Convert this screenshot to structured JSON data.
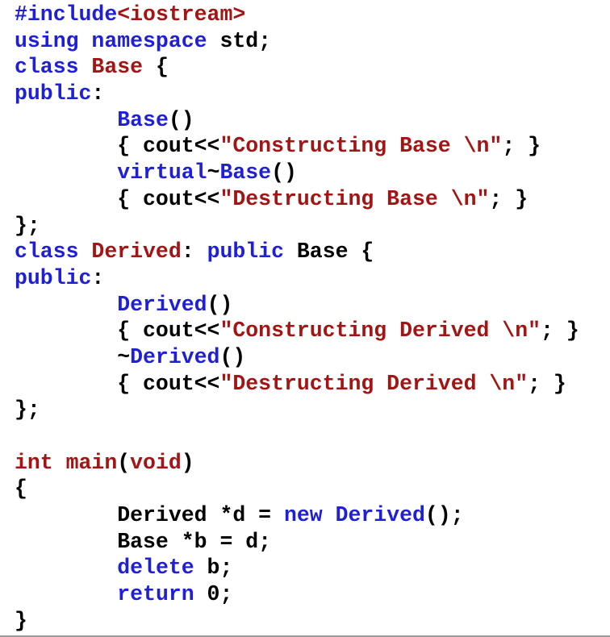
{
  "code": {
    "lines": [
      [
        {
          "t": "#include",
          "c": "blue"
        },
        {
          "t": "<iostream>",
          "c": "red"
        }
      ],
      [
        {
          "t": "using",
          "c": "blue"
        },
        {
          "t": " ",
          "c": "black"
        },
        {
          "t": "namespace",
          "c": "blue"
        },
        {
          "t": " std;",
          "c": "black"
        }
      ],
      [
        {
          "t": "class",
          "c": "blue"
        },
        {
          "t": " ",
          "c": "black"
        },
        {
          "t": "Base",
          "c": "red"
        },
        {
          "t": " {",
          "c": "black"
        }
      ],
      [
        {
          "t": "public",
          "c": "blue"
        },
        {
          "t": ":",
          "c": "black"
        }
      ],
      [
        {
          "t": "        ",
          "c": "black"
        },
        {
          "t": "Base",
          "c": "blue"
        },
        {
          "t": "()",
          "c": "black"
        }
      ],
      [
        {
          "t": "        { cout<<",
          "c": "black"
        },
        {
          "t": "\"Constructing Base \\n\"",
          "c": "red"
        },
        {
          "t": "; }",
          "c": "black"
        }
      ],
      [
        {
          "t": "        ",
          "c": "black"
        },
        {
          "t": "virtual",
          "c": "blue"
        },
        {
          "t": "~",
          "c": "black"
        },
        {
          "t": "Base",
          "c": "blue"
        },
        {
          "t": "()",
          "c": "black"
        }
      ],
      [
        {
          "t": "        { cout<<",
          "c": "black"
        },
        {
          "t": "\"Destructing Base \\n\"",
          "c": "red"
        },
        {
          "t": "; }",
          "c": "black"
        }
      ],
      [
        {
          "t": "};",
          "c": "black"
        }
      ],
      [
        {
          "t": "class",
          "c": "blue"
        },
        {
          "t": " ",
          "c": "black"
        },
        {
          "t": "Derived",
          "c": "red"
        },
        {
          "t": ": ",
          "c": "black"
        },
        {
          "t": "public",
          "c": "blue"
        },
        {
          "t": " Base {",
          "c": "black"
        }
      ],
      [
        {
          "t": "public",
          "c": "blue"
        },
        {
          "t": ":",
          "c": "black"
        }
      ],
      [
        {
          "t": "        ",
          "c": "black"
        },
        {
          "t": "Derived",
          "c": "blue"
        },
        {
          "t": "()",
          "c": "black"
        }
      ],
      [
        {
          "t": "        { cout<<",
          "c": "black"
        },
        {
          "t": "\"Constructing Derived \\n\"",
          "c": "red"
        },
        {
          "t": "; }",
          "c": "black"
        }
      ],
      [
        {
          "t": "        ~",
          "c": "black"
        },
        {
          "t": "Derived",
          "c": "blue"
        },
        {
          "t": "()",
          "c": "black"
        }
      ],
      [
        {
          "t": "        { cout<<",
          "c": "black"
        },
        {
          "t": "\"Destructing Derived \\n\"",
          "c": "red"
        },
        {
          "t": "; }",
          "c": "black"
        }
      ],
      [
        {
          "t": "};",
          "c": "black"
        }
      ],
      [
        {
          "t": "",
          "c": "black"
        }
      ],
      [
        {
          "t": "int",
          "c": "red"
        },
        {
          "t": " ",
          "c": "black"
        },
        {
          "t": "main",
          "c": "red"
        },
        {
          "t": "(",
          "c": "black"
        },
        {
          "t": "void",
          "c": "red"
        },
        {
          "t": ")",
          "c": "black"
        }
      ],
      [
        {
          "t": "{",
          "c": "black"
        }
      ],
      [
        {
          "t": "        Derived *d = ",
          "c": "black"
        },
        {
          "t": "new",
          "c": "blue"
        },
        {
          "t": " ",
          "c": "black"
        },
        {
          "t": "Derived",
          "c": "blue"
        },
        {
          "t": "();",
          "c": "black"
        }
      ],
      [
        {
          "t": "        Base *b = d;",
          "c": "black"
        }
      ],
      [
        {
          "t": "        ",
          "c": "black"
        },
        {
          "t": "delete",
          "c": "blue"
        },
        {
          "t": " b;",
          "c": "black"
        }
      ],
      [
        {
          "t": "        ",
          "c": "black"
        },
        {
          "t": "return",
          "c": "blue"
        },
        {
          "t": " 0;",
          "c": "black"
        }
      ],
      [
        {
          "t": "}",
          "c": "black"
        }
      ]
    ]
  },
  "colors": {
    "keyword": "#1f1fd6",
    "string_and_type": "#a31515",
    "text": "#000000",
    "background": "#ffffff"
  }
}
